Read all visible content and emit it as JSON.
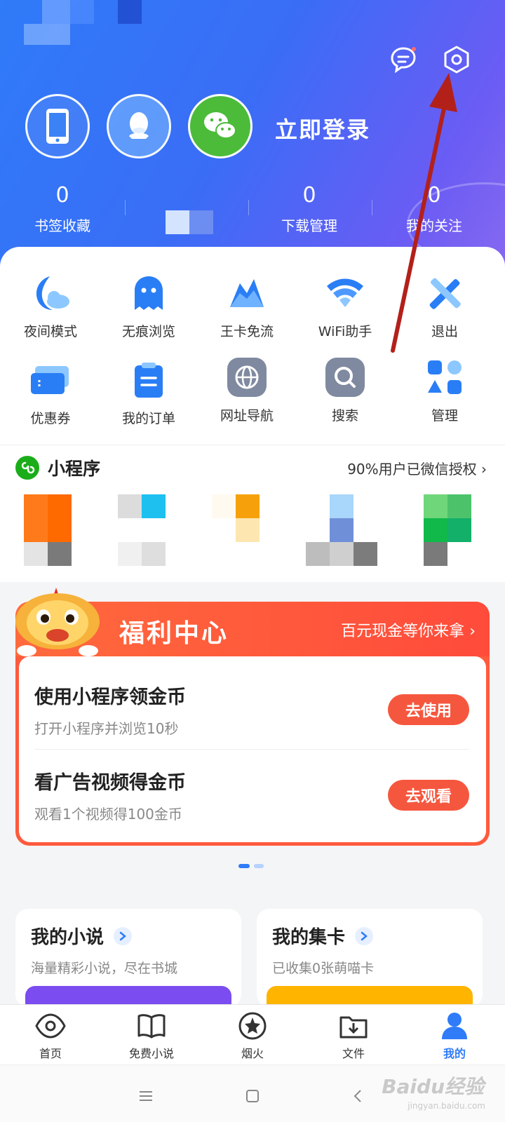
{
  "header": {
    "login_text": "立即登录",
    "stats": [
      {
        "value": "0",
        "label": "书签收藏"
      },
      {
        "value": "0",
        "label": "下载管理"
      },
      {
        "value": "0",
        "label": "我的关注"
      }
    ]
  },
  "tools": [
    {
      "label": "夜间模式",
      "icon": "moon-cloud-icon"
    },
    {
      "label": "无痕浏览",
      "icon": "ghost-icon"
    },
    {
      "label": "王卡免流",
      "icon": "crown-mountain-icon"
    },
    {
      "label": "WiFi助手",
      "icon": "wifi-icon"
    },
    {
      "label": "退出",
      "icon": "exit-cross-icon"
    },
    {
      "label": "优惠券",
      "icon": "coupon-icon"
    },
    {
      "label": "我的订单",
      "icon": "order-clipboard-icon"
    },
    {
      "label": "网址导航",
      "icon": "globe-icon"
    },
    {
      "label": "搜索",
      "icon": "search-icon"
    },
    {
      "label": "管理",
      "icon": "grid-manage-icon"
    }
  ],
  "mini_programs": {
    "title": "小程序",
    "right_text": "90%用户已微信授权"
  },
  "welfare": {
    "title": "福利中心",
    "right_text": "百元现金等你来拿",
    "tasks": [
      {
        "title": "使用小程序领金币",
        "subtitle": "打开小程序并浏览10秒",
        "button": "去使用"
      },
      {
        "title": "看广告视频得金币",
        "subtitle": "观看1个视频得100金币",
        "button": "去观看"
      }
    ]
  },
  "cards": [
    {
      "title": "我的小说",
      "subtitle": "海量精彩小说，尽在书城",
      "strip_color": "#7b4cf0"
    },
    {
      "title": "我的集卡",
      "subtitle": "已收集0张萌喵卡",
      "strip_color": "#ffb400"
    }
  ],
  "tabbar": [
    {
      "label": "首页",
      "icon": "eye-icon"
    },
    {
      "label": "免费小说",
      "icon": "book-icon"
    },
    {
      "label": "烟火",
      "icon": "firework-icon"
    },
    {
      "label": "文件",
      "icon": "folder-download-icon"
    },
    {
      "label": "我的",
      "icon": "person-icon",
      "active": true
    }
  ],
  "colors": {
    "accent": "#2f7bf8",
    "welfare": "#ff5a3c",
    "active_tab": "#2f7bf8"
  },
  "watermark": {
    "brand": "Baidu经验",
    "url": "jingyan.baidu.com"
  }
}
